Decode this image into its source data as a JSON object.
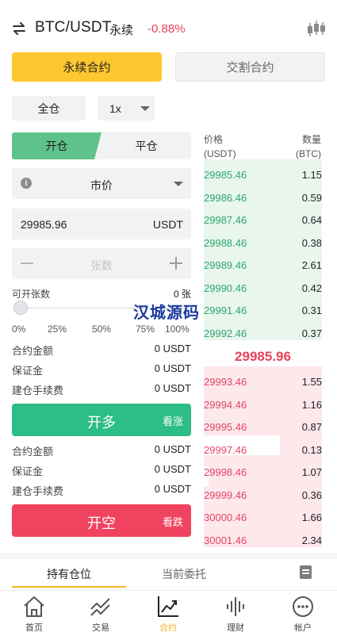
{
  "header": {
    "pair": "BTC/USDT",
    "contract_type": "永续",
    "change": "-0.88%"
  },
  "contract_tabs": {
    "perpetual": "永续合约",
    "delivery": "交割合约"
  },
  "margin_mode": "全仓",
  "leverage": "1x",
  "order_side_tabs": {
    "open": "开仓",
    "close": "平仓"
  },
  "order_type": "市价",
  "price": {
    "value": "29985.96",
    "unit": "USDT"
  },
  "quantity": {
    "placeholder": "张数"
  },
  "available": {
    "label": "可开张数",
    "value": "0 张"
  },
  "slider": {
    "value_fraction": 0,
    "marks": [
      "0%",
      "25%",
      "50%",
      "75%",
      "100%"
    ]
  },
  "long_summary": [
    {
      "label": "合约金额",
      "value": "0 USDT"
    },
    {
      "label": "保证金",
      "value": "0 USDT"
    },
    {
      "label": "建仓手续费",
      "value": "0 USDT"
    }
  ],
  "short_summary": [
    {
      "label": "合约金额",
      "value": "0 USDT"
    },
    {
      "label": "保证金",
      "value": "0 USDT"
    },
    {
      "label": "建仓手续费",
      "value": "0 USDT"
    }
  ],
  "buttons": {
    "long_main": "开多",
    "long_sub": "看涨",
    "short_main": "开空",
    "short_sub": "看跌"
  },
  "orderbook": {
    "price_header": "价格",
    "price_unit": "(USDT)",
    "qty_header": "数量",
    "qty_unit": "(BTC)",
    "last_price": "29985.96",
    "bids": [
      {
        "price": "29985.46",
        "qty": "1.15"
      },
      {
        "price": "29986.46",
        "qty": "0.59"
      },
      {
        "price": "29987.46",
        "qty": "0.64"
      },
      {
        "price": "29988.46",
        "qty": "0.38"
      },
      {
        "price": "29989.46",
        "qty": "2.61"
      },
      {
        "price": "29990.46",
        "qty": "0.42"
      },
      {
        "price": "29991.46",
        "qty": "0.31"
      },
      {
        "price": "29992.46",
        "qty": "0.37"
      }
    ],
    "asks": [
      {
        "price": "29993.46",
        "qty": "1.55"
      },
      {
        "price": "29994.46",
        "qty": "1.16"
      },
      {
        "price": "29995.46",
        "qty": "0.87"
      },
      {
        "price": "29997.46",
        "qty": "0.13"
      },
      {
        "price": "29998.46",
        "qty": "1.07"
      },
      {
        "price": "29999.46",
        "qty": "0.36"
      },
      {
        "price": "30000.46",
        "qty": "1.66"
      },
      {
        "price": "30001.46",
        "qty": "2.34"
      }
    ]
  },
  "watermark": "汉城源码",
  "bottom_tabs": {
    "positions": "持有仓位",
    "orders": "当前委托"
  },
  "nav": [
    {
      "label": "首页",
      "icon": "home-icon"
    },
    {
      "label": "交易",
      "icon": "trade-icon"
    },
    {
      "label": "合约",
      "icon": "contract-icon"
    },
    {
      "label": "理财",
      "icon": "finance-icon"
    },
    {
      "label": "帐户",
      "icon": "account-icon"
    }
  ],
  "colors": {
    "accent": "#fdc72f",
    "up": "#2dbd86",
    "down": "#f0435f"
  }
}
